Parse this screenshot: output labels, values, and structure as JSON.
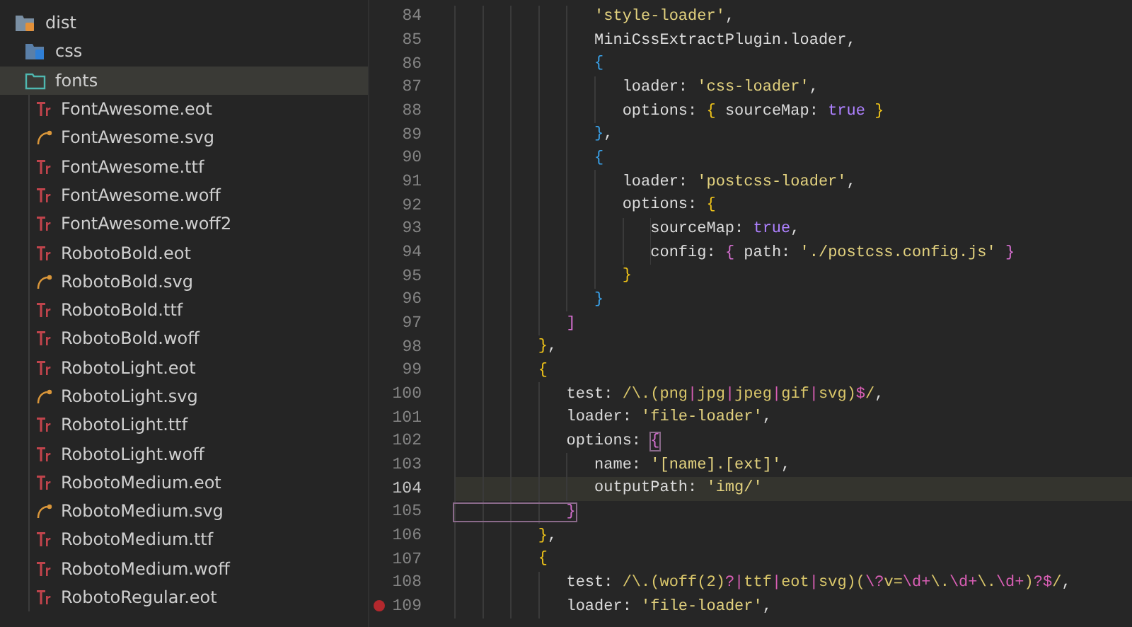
{
  "explorer": {
    "items": [
      {
        "label": "dist",
        "kind": "folder-dist",
        "selected": false,
        "children": [
          {
            "label": "css",
            "kind": "folder-css",
            "selected": false
          },
          {
            "label": "fonts",
            "kind": "folder-open",
            "selected": true,
            "children": [
              {
                "label": "FontAwesome.eot",
                "kind": "font",
                "selected": false
              },
              {
                "label": "FontAwesome.svg",
                "kind": "svg",
                "selected": false
              },
              {
                "label": "FontAwesome.ttf",
                "kind": "font",
                "selected": false
              },
              {
                "label": "FontAwesome.woff",
                "kind": "font",
                "selected": false
              },
              {
                "label": "FontAwesome.woff2",
                "kind": "font",
                "selected": false
              },
              {
                "label": "RobotoBold.eot",
                "kind": "font",
                "selected": false
              },
              {
                "label": "RobotoBold.svg",
                "kind": "svg",
                "selected": false
              },
              {
                "label": "RobotoBold.ttf",
                "kind": "font",
                "selected": false
              },
              {
                "label": "RobotoBold.woff",
                "kind": "font",
                "selected": false
              },
              {
                "label": "RobotoLight.eot",
                "kind": "font",
                "selected": false
              },
              {
                "label": "RobotoLight.svg",
                "kind": "svg",
                "selected": false
              },
              {
                "label": "RobotoLight.ttf",
                "kind": "font",
                "selected": false
              },
              {
                "label": "RobotoLight.woff",
                "kind": "font",
                "selected": false
              },
              {
                "label": "RobotoMedium.eot",
                "kind": "font",
                "selected": false
              },
              {
                "label": "RobotoMedium.svg",
                "kind": "svg",
                "selected": false
              },
              {
                "label": "RobotoMedium.ttf",
                "kind": "font",
                "selected": false
              },
              {
                "label": "RobotoMedium.woff",
                "kind": "font",
                "selected": false
              },
              {
                "label": "RobotoRegular.eot",
                "kind": "font",
                "selected": false
              }
            ]
          }
        ]
      }
    ]
  },
  "editor": {
    "lines": [
      {
        "number": "84",
        "current": false,
        "breakpoint": false,
        "tokens": [
          {
            "kind": "string",
            "text": "               'style-loader'"
          },
          {
            "kind": "plain",
            "text": ","
          }
        ]
      },
      {
        "number": "85",
        "current": false,
        "breakpoint": false,
        "tokens": [
          {
            "kind": "plain",
            "text": "               MiniCssExtractPlugin.loader,"
          }
        ]
      },
      {
        "number": "86",
        "current": false,
        "breakpoint": false,
        "tokens": [
          {
            "kind": "brace-blue",
            "text": "               {"
          }
        ]
      },
      {
        "number": "87",
        "current": false,
        "breakpoint": false,
        "tokens": [
          {
            "kind": "plain",
            "text": "                  loader: "
          },
          {
            "kind": "string",
            "text": "'css-loader'"
          },
          {
            "kind": "plain",
            "text": ","
          }
        ]
      },
      {
        "number": "88",
        "current": false,
        "breakpoint": false,
        "tokens": [
          {
            "kind": "plain",
            "text": "                  options: "
          },
          {
            "kind": "brace-gold",
            "text": "{"
          },
          {
            "kind": "plain",
            "text": " sourceMap: "
          },
          {
            "kind": "bool",
            "text": "true "
          },
          {
            "kind": "brace-gold",
            "text": "}"
          }
        ]
      },
      {
        "number": "89",
        "current": false,
        "breakpoint": false,
        "tokens": [
          {
            "kind": "brace-blue",
            "text": "               }"
          },
          {
            "kind": "plain",
            "text": ","
          }
        ]
      },
      {
        "number": "90",
        "current": false,
        "breakpoint": false,
        "tokens": [
          {
            "kind": "brace-blue",
            "text": "               {"
          }
        ]
      },
      {
        "number": "91",
        "current": false,
        "breakpoint": false,
        "tokens": [
          {
            "kind": "plain",
            "text": "                  loader: "
          },
          {
            "kind": "string",
            "text": "'postcss-loader'"
          },
          {
            "kind": "plain",
            "text": ","
          }
        ]
      },
      {
        "number": "92",
        "current": false,
        "breakpoint": false,
        "tokens": [
          {
            "kind": "plain",
            "text": "                  options: "
          },
          {
            "kind": "brace-gold",
            "text": "{"
          }
        ]
      },
      {
        "number": "93",
        "current": false,
        "breakpoint": false,
        "tokens": [
          {
            "kind": "plain",
            "text": "                     sourceMap: "
          },
          {
            "kind": "bool",
            "text": "true"
          },
          {
            "kind": "plain",
            "text": ","
          }
        ]
      },
      {
        "number": "94",
        "current": false,
        "breakpoint": false,
        "tokens": [
          {
            "kind": "plain",
            "text": "                     config: "
          },
          {
            "kind": "brace-pink",
            "text": "{"
          },
          {
            "kind": "plain",
            "text": " path: "
          },
          {
            "kind": "string",
            "text": "'./postcss.config.js' "
          },
          {
            "kind": "brace-pink",
            "text": "}"
          }
        ]
      },
      {
        "number": "95",
        "current": false,
        "breakpoint": false,
        "tokens": [
          {
            "kind": "brace-gold",
            "text": "                  }"
          }
        ]
      },
      {
        "number": "96",
        "current": false,
        "breakpoint": false,
        "tokens": [
          {
            "kind": "brace-blue",
            "text": "               }"
          }
        ]
      },
      {
        "number": "97",
        "current": false,
        "breakpoint": false,
        "tokens": [
          {
            "kind": "brace-pink",
            "text": "            ]"
          }
        ]
      },
      {
        "number": "98",
        "current": false,
        "breakpoint": false,
        "tokens": [
          {
            "kind": "brace-gold",
            "text": "         }"
          },
          {
            "kind": "plain",
            "text": ","
          }
        ]
      },
      {
        "number": "99",
        "current": false,
        "breakpoint": false,
        "tokens": [
          {
            "kind": "brace-gold",
            "text": "         {"
          }
        ]
      },
      {
        "number": "100",
        "current": false,
        "breakpoint": false,
        "tokens": [
          {
            "kind": "plain",
            "text": "            test: "
          },
          {
            "kind": "regex",
            "text": "/\\.(png"
          },
          {
            "kind": "regex-op",
            "text": "|"
          },
          {
            "kind": "regex",
            "text": "jpg"
          },
          {
            "kind": "regex-op",
            "text": "|"
          },
          {
            "kind": "regex",
            "text": "jpeg"
          },
          {
            "kind": "regex-op",
            "text": "|"
          },
          {
            "kind": "regex",
            "text": "gif"
          },
          {
            "kind": "regex-op",
            "text": "|"
          },
          {
            "kind": "regex",
            "text": "svg)"
          },
          {
            "kind": "regex-op",
            "text": "$"
          },
          {
            "kind": "regex",
            "text": "/"
          },
          {
            "kind": "plain",
            "text": ","
          }
        ]
      },
      {
        "number": "101",
        "current": false,
        "breakpoint": false,
        "tokens": [
          {
            "kind": "plain",
            "text": "            loader: "
          },
          {
            "kind": "string",
            "text": "'file-loader'"
          },
          {
            "kind": "plain",
            "text": ","
          }
        ]
      },
      {
        "number": "102",
        "current": false,
        "breakpoint": false,
        "tokens": [
          {
            "kind": "plain",
            "text": "            options: "
          },
          {
            "kind": "brace-match",
            "text": "{"
          }
        ]
      },
      {
        "number": "103",
        "current": false,
        "breakpoint": false,
        "tokens": [
          {
            "kind": "plain",
            "text": "               name: "
          },
          {
            "kind": "string",
            "text": "'[name].[ext]'"
          },
          {
            "kind": "plain",
            "text": ","
          }
        ]
      },
      {
        "number": "104",
        "current": true,
        "breakpoint": false,
        "tokens": [
          {
            "kind": "plain",
            "text": "               outputPath: "
          },
          {
            "kind": "string",
            "text": "'img/'"
          }
        ]
      },
      {
        "number": "105",
        "current": false,
        "breakpoint": false,
        "tokens": [
          {
            "kind": "brace-match",
            "text": "            }"
          }
        ]
      },
      {
        "number": "106",
        "current": false,
        "breakpoint": false,
        "tokens": [
          {
            "kind": "brace-gold",
            "text": "         }"
          },
          {
            "kind": "plain",
            "text": ","
          }
        ]
      },
      {
        "number": "107",
        "current": false,
        "breakpoint": false,
        "tokens": [
          {
            "kind": "brace-gold",
            "text": "         {"
          }
        ]
      },
      {
        "number": "108",
        "current": false,
        "breakpoint": false,
        "tokens": [
          {
            "kind": "plain",
            "text": "            test: "
          },
          {
            "kind": "regex",
            "text": "/\\.(woff(2)"
          },
          {
            "kind": "regex-op",
            "text": "?|"
          },
          {
            "kind": "regex",
            "text": "ttf"
          },
          {
            "kind": "regex-op",
            "text": "|"
          },
          {
            "kind": "regex",
            "text": "eot"
          },
          {
            "kind": "regex-op",
            "text": "|"
          },
          {
            "kind": "regex",
            "text": "svg)("
          },
          {
            "kind": "regex-op",
            "text": "\\?"
          },
          {
            "kind": "regex",
            "text": "v="
          },
          {
            "kind": "regex-op",
            "text": "\\d+"
          },
          {
            "kind": "regex",
            "text": "\\."
          },
          {
            "kind": "regex-op",
            "text": "\\d+"
          },
          {
            "kind": "regex",
            "text": "\\."
          },
          {
            "kind": "regex-op",
            "text": "\\d+"
          },
          {
            "kind": "regex",
            "text": ")"
          },
          {
            "kind": "regex-op",
            "text": "?$"
          },
          {
            "kind": "regex",
            "text": "/"
          },
          {
            "kind": "plain",
            "text": ","
          }
        ]
      },
      {
        "number": "109",
        "current": false,
        "breakpoint": true,
        "tokens": [
          {
            "kind": "plain",
            "text": "            loader: "
          },
          {
            "kind": "string",
            "text": "'file-loader'"
          },
          {
            "kind": "plain",
            "text": ","
          }
        ]
      }
    ]
  }
}
